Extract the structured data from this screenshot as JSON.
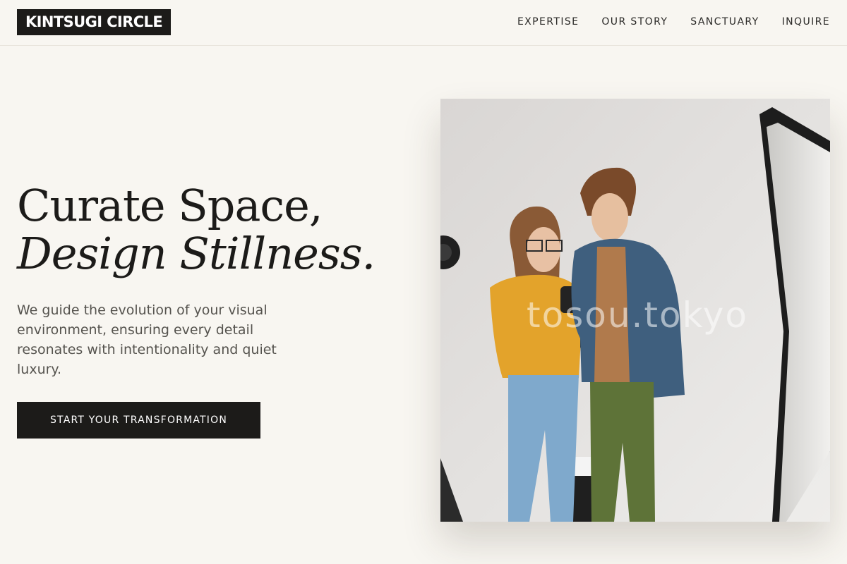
{
  "header": {
    "logo": "KINTSUGI CIRCLE",
    "nav": [
      "EXPERTISE",
      "OUR STORY",
      "SANCTUARY",
      "INQUIRE"
    ]
  },
  "hero": {
    "title_line1": "Curate Space,",
    "title_line2": "Design Stillness.",
    "subtitle": "We guide the evolution of your visual environment, ensuring every detail resonates with intentionality and quiet luxury.",
    "cta_label": "START YOUR TRANSFORMATION"
  },
  "photo": {
    "watermark": "tosou.tokyo"
  },
  "colors": {
    "background": "#f8f6f1",
    "ink": "#1c1b19",
    "muted_text": "#55534e",
    "divider": "#e8e4dc"
  }
}
